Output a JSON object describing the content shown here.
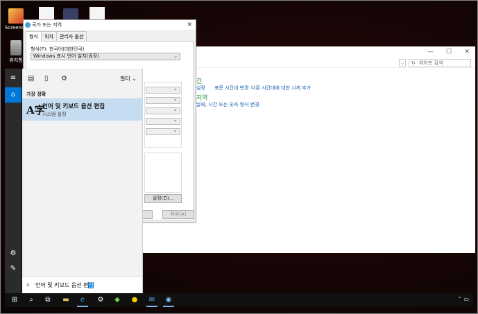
{
  "desktop": {
    "icons": [
      {
        "label": "Screensh"
      },
      {
        "label": ""
      },
      {
        "label": ""
      },
      {
        "label": ""
      },
      {
        "label": "휴지통"
      }
    ]
  },
  "control_panel": {
    "search_placeholder": "제어판 검색",
    "heading1": "간",
    "link_row1": [
      "설정",
      "표준 시간대 변경",
      "다른 시간대에 대한 시계 추가"
    ],
    "heading2": "지역",
    "link_row2": "날짜, 시간 또는 숫자 형식 변경"
  },
  "region_dialog": {
    "title": "국가 또는 지역",
    "tabs": [
      "형식",
      "위치",
      "관리자 옵션"
    ],
    "format_label": "형식(F): 한국어(대한민국)",
    "format_value": "Windows 표시 언어 일치(권장)",
    "additional_settings": "설정(D)...",
    "cancel": "소",
    "apply": "적용(A)"
  },
  "start_menu": {
    "filter_label": "필터",
    "best_match_label": "가장 정확",
    "result_title": "언어 및 키보드 옵션 편집",
    "result_subtitle": "시스템 설정",
    "query_prefix": "언어 및 키보드 옵션 편",
    "query_selected": "집"
  },
  "taskbar": {
    "items": [
      "start-icon",
      "search-icon",
      "task-view-icon",
      "file-explorer-icon",
      "edge-icon",
      "settings-icon",
      "app-icon",
      "kakaotalk-icon",
      "mail-icon",
      "region-icon"
    ]
  },
  "colors": {
    "accent": "#0078d7",
    "result_highlight": "#c6dcf1",
    "link": "#1a5fb4",
    "heading_green": "#2a8a3a"
  }
}
